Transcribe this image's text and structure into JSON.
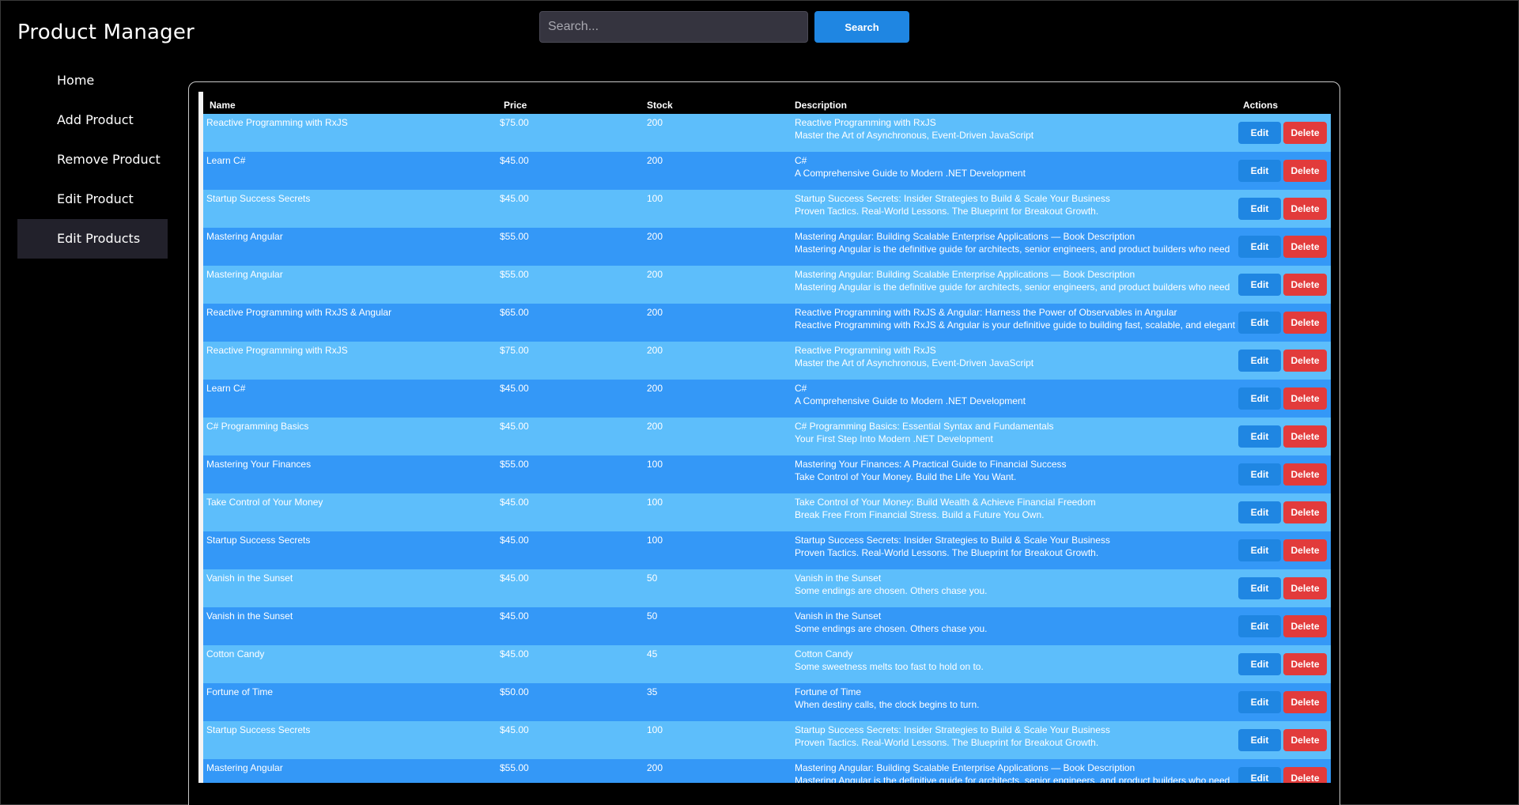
{
  "app": {
    "title": "Product Manager"
  },
  "search": {
    "placeholder": "Search...",
    "value": "",
    "button_label": "Search"
  },
  "sidebar": {
    "items": [
      {
        "label": "Home",
        "active": false
      },
      {
        "label": "Add Product",
        "active": false
      },
      {
        "label": "Remove Product",
        "active": false
      },
      {
        "label": "Edit Product",
        "active": false
      },
      {
        "label": "Edit Products",
        "active": true
      }
    ]
  },
  "table": {
    "columns": [
      "Name",
      "Price",
      "Stock",
      "Description",
      "Actions"
    ],
    "edit_label": "Edit",
    "delete_label": "Delete",
    "rows": [
      {
        "name": "Reactive Programming with RxJS",
        "price": "$75.00",
        "stock": "200",
        "desc1": "Reactive Programming with RxJS",
        "desc2": "Master the Art of Asynchronous, Event-Driven JavaScript"
      },
      {
        "name": "Learn C#",
        "price": "$45.00",
        "stock": "200",
        "desc1": "C#",
        "desc2": "A Comprehensive Guide to Modern .NET Development"
      },
      {
        "name": "Startup Success Secrets",
        "price": "$45.00",
        "stock": "100",
        "desc1": "Startup Success Secrets: Insider Strategies to Build & Scale Your Business",
        "desc2": "Proven Tactics. Real-World Lessons. The Blueprint for Breakout Growth."
      },
      {
        "name": "Mastering Angular",
        "price": "$55.00",
        "stock": "200",
        "desc1": "Mastering Angular: Building Scalable Enterprise Applications — Book Description",
        "desc2": "Mastering Angular is the definitive guide for architects, senior engineers, and product builders who need"
      },
      {
        "name": "Mastering Angular",
        "price": "$55.00",
        "stock": "200",
        "desc1": "Mastering Angular: Building Scalable Enterprise Applications — Book Description",
        "desc2": "Mastering Angular is the definitive guide for architects, senior engineers, and product builders who need"
      },
      {
        "name": "Reactive Programming with RxJS & Angular",
        "price": "$65.00",
        "stock": "200",
        "desc1": "Reactive Programming with RxJS & Angular: Harness the Power of Observables in Angular",
        "desc2": "",
        "desc3": "Reactive Programming with RxJS & Angular is your definitive guide to building fast, scalable, and elegant"
      },
      {
        "name": "Reactive Programming with RxJS",
        "price": "$75.00",
        "stock": "200",
        "desc1": "Reactive Programming with RxJS",
        "desc2": "Master the Art of Asynchronous, Event-Driven JavaScript"
      },
      {
        "name": "Learn C#",
        "price": "$45.00",
        "stock": "200",
        "desc1": "C#",
        "desc2": "A Comprehensive Guide to Modern .NET Development"
      },
      {
        "name": "C# Programming Basics",
        "price": "$45.00",
        "stock": "200",
        "desc1": "C# Programming Basics: Essential Syntax and Fundamentals",
        "desc2": "Your First Step Into Modern .NET Development"
      },
      {
        "name": "Mastering Your Finances",
        "price": "$55.00",
        "stock": "100",
        "desc1": "Mastering Your Finances: A Practical Guide to Financial Success",
        "desc2": "Take Control of Your Money. Build the Life You Want."
      },
      {
        "name": "Take Control of Your Money",
        "price": "$45.00",
        "stock": "100",
        "desc1": "Take Control of Your Money: Build Wealth & Achieve Financial Freedom",
        "desc2": "Break Free From Financial Stress. Build a Future You Own."
      },
      {
        "name": "Startup Success Secrets",
        "price": "$45.00",
        "stock": "100",
        "desc1": "Startup Success Secrets: Insider Strategies to Build & Scale Your Business",
        "desc2": "Proven Tactics. Real-World Lessons. The Blueprint for Breakout Growth."
      },
      {
        "name": "Vanish in the Sunset",
        "price": "$45.00",
        "stock": "50",
        "desc1": "Vanish in the Sunset",
        "desc2": "Some endings are chosen. Others chase you."
      },
      {
        "name": "Vanish in the Sunset",
        "price": "$45.00",
        "stock": "50",
        "desc1": "Vanish in the Sunset",
        "desc2": "Some endings are chosen. Others chase you."
      },
      {
        "name": "Cotton Candy",
        "price": "$45.00",
        "stock": "45",
        "desc1": "Cotton Candy",
        "desc2": "Some sweetness melts too fast to hold on to."
      },
      {
        "name": "Fortune of Time",
        "price": "$50.00",
        "stock": "35",
        "desc1": "Fortune of Time",
        "desc2": "When destiny calls, the clock begins to turn."
      },
      {
        "name": "Startup Success Secrets",
        "price": "$45.00",
        "stock": "100",
        "desc1": "Startup Success Secrets: Insider Strategies to Build & Scale Your Business",
        "desc2": "Proven Tactics. Real-World Lessons. The Blueprint for Breakout Growth."
      },
      {
        "name": "Mastering Angular",
        "price": "$55.00",
        "stock": "200",
        "desc1": "Mastering Angular: Building Scalable Enterprise Applications — Book Description",
        "desc2": "Mastering Angular is the definitive guide for architects, senior engineers, and product builders who need"
      }
    ]
  },
  "colors": {
    "row_light": "#5dbefb",
    "row_dark": "#3498f7",
    "edit_button": "#1f86e2",
    "delete_button": "#e23b3b",
    "active_nav": "#22212b"
  }
}
